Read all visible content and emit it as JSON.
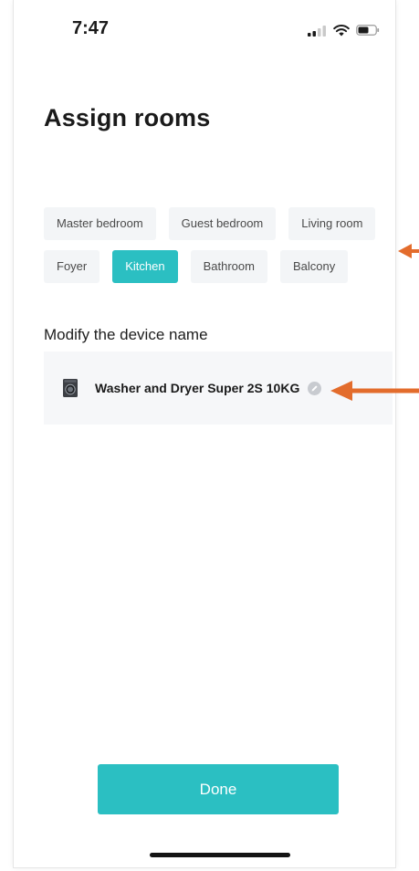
{
  "status_bar": {
    "time": "7:47",
    "icons": [
      "signal-icon",
      "wifi-icon",
      "battery-icon"
    ]
  },
  "page": {
    "title": "Assign rooms"
  },
  "rooms": [
    {
      "label": "Master bedroom",
      "selected": false
    },
    {
      "label": "Guest bedroom",
      "selected": false
    },
    {
      "label": "Living room",
      "selected": false
    },
    {
      "label": "Foyer",
      "selected": false
    },
    {
      "label": "Kitchen",
      "selected": true
    },
    {
      "label": "Bathroom",
      "selected": false
    },
    {
      "label": "Balcony",
      "selected": false
    }
  ],
  "device_section": {
    "label": "Modify the device name",
    "device_name": "Washer and Dryer Super 2S 10KG",
    "device_icon": "washer-dryer-icon",
    "edit_icon": "edit-pencil-icon"
  },
  "footer": {
    "done_label": "Done"
  },
  "colors": {
    "accent": "#2bbfc2",
    "chip_background": "#f3f5f7",
    "annotation_arrow": "#e36c2c"
  }
}
